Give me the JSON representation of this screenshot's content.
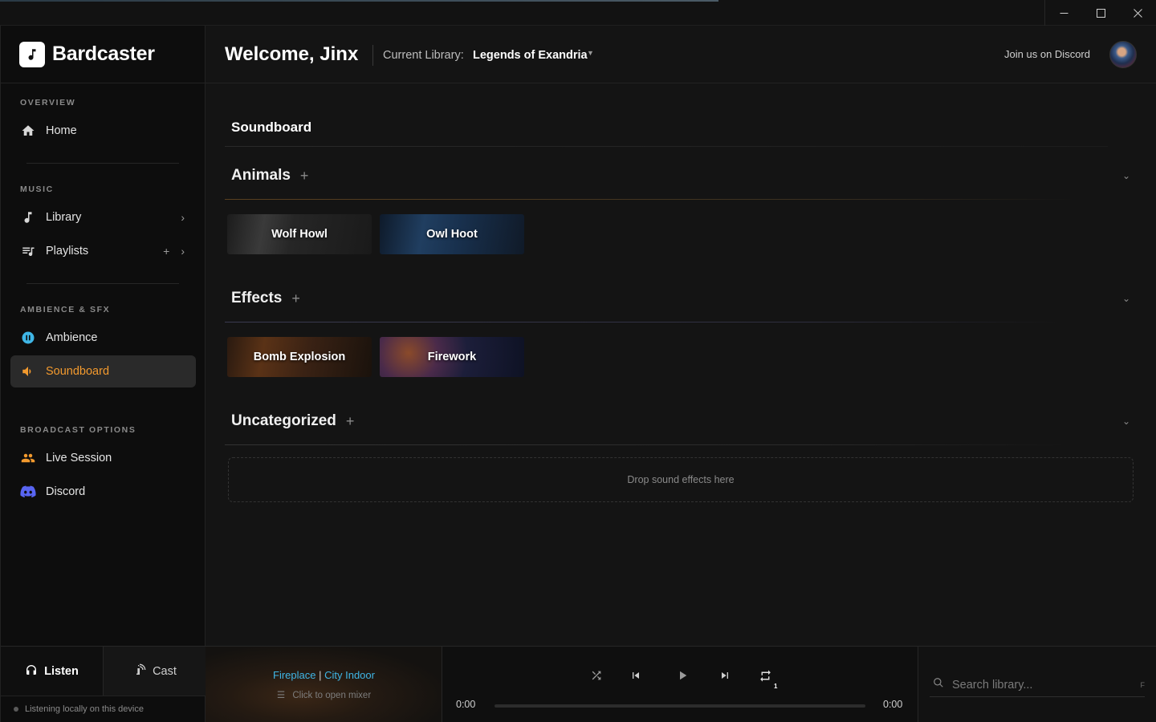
{
  "window": {
    "minimize": "—",
    "maximize": "☐",
    "close": "✕"
  },
  "brand": {
    "name": "Bardcaster"
  },
  "sidebar": {
    "sections": {
      "overview": "OVERVIEW",
      "music": "MUSIC",
      "ambience": "AMBIENCE & SFX",
      "broadcast": "BROADCAST OPTIONS"
    },
    "items": {
      "home": "Home",
      "library": "Library",
      "playlists": "Playlists",
      "ambience": "Ambience",
      "soundboard": "Soundboard",
      "live_session": "Live Session",
      "discord": "Discord"
    },
    "active": "soundboard",
    "modes": {
      "listen": "Listen",
      "cast": "Cast"
    },
    "status": "Listening locally on this device"
  },
  "header": {
    "welcome": "Welcome, Jinx",
    "library_label": "Current Library:",
    "library_name": "Legends of Exandria",
    "discord_link": "Join us on Discord"
  },
  "main": {
    "title": "Soundboard",
    "categories": [
      {
        "name": "Animals",
        "sounds": [
          "Wolf Howl",
          "Owl Hoot"
        ]
      },
      {
        "name": "Effects",
        "sounds": [
          "Bomb Explosion",
          "Firework"
        ]
      },
      {
        "name": "Uncategorized",
        "sounds": []
      }
    ],
    "drop_hint": "Drop sound effects here"
  },
  "player": {
    "track_a": "Fireplace",
    "track_sep": "|",
    "track_b": "City Indoor",
    "mixer_hint": "Click to open mixer",
    "time_current": "0:00",
    "time_total": "0:00",
    "progress": 0,
    "repeat_count": "1"
  },
  "search": {
    "placeholder": "Search library...",
    "hint": "F"
  },
  "colors": {
    "accent": "#f39a2e",
    "ambience": "#3fb6e6",
    "discord": "#5865f2"
  }
}
